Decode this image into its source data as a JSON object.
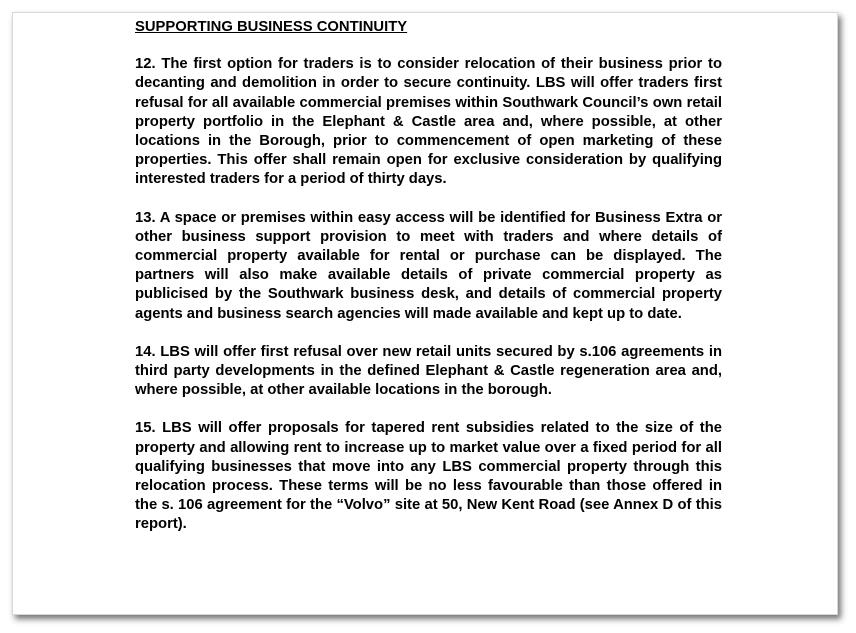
{
  "document": {
    "heading": "SUPPORTING BUSINESS CONTINUITY",
    "paragraphs": [
      "12. The first option for traders is to consider relocation of their business prior to decanting and demolition in order to secure continuity. LBS will offer traders first refusal for all available commercial premises within Southwark Council’s own retail property portfolio in the Elephant & Castle area and, where possible, at other locations in the Borough, prior to commencement of open marketing of these properties. This offer shall remain open for exclusive consideration by qualifying interested traders for a period of thirty days.",
      "13. A space or premises within easy access will be identified for Business Extra or other business support provision to meet with traders and where details of commercial property available for rental or purchase can be displayed. The partners will also make available details of private commercial property as publicised by the Southwark business desk, and details of commercial property agents and business search agencies will made available and kept up to date.",
      "14. LBS will offer first refusal over new retail units secured by s.106 agreements in third party developments in the defined Elephant & Castle regeneration area and, where possible, at other available locations in the borough.",
      "15. LBS will offer proposals for tapered rent subsidies related to the size of the property and allowing rent to increase up to market value over a fixed period for all qualifying businesses that move into any LBS commercial property through this relocation process. These terms will be no less favourable than those offered in the s. 106 agreement for the “Volvo” site at 50, New Kent Road (see Annex D of this report)."
    ]
  }
}
